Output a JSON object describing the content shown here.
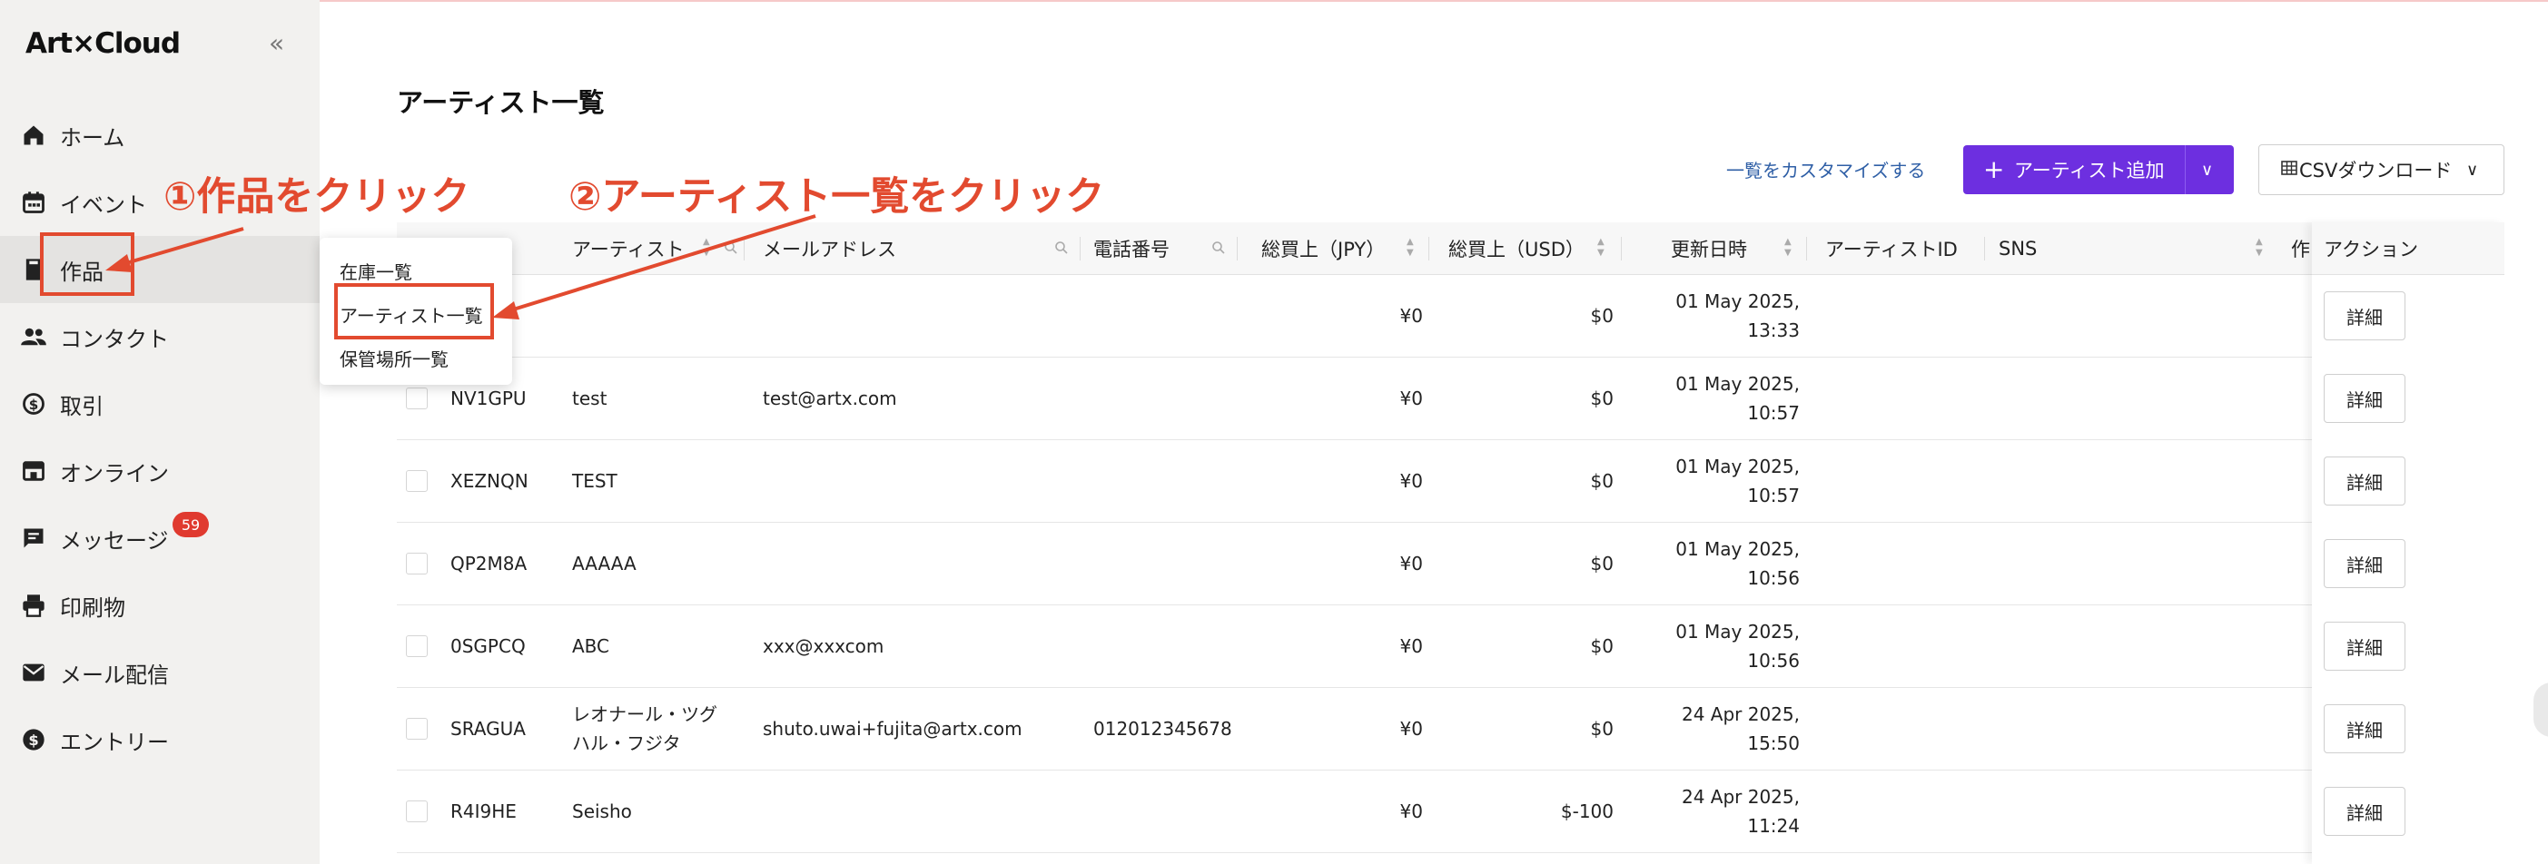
{
  "app": {
    "logo": "Art×Cloud"
  },
  "sidebar": {
    "items": [
      {
        "label": "ホーム",
        "icon": "home-icon"
      },
      {
        "label": "イベント",
        "icon": "calendar-icon"
      },
      {
        "label": "作品",
        "icon": "book-icon"
      },
      {
        "label": "コンタクト",
        "icon": "people-icon"
      },
      {
        "label": "取引",
        "icon": "exchange-icon"
      },
      {
        "label": "オンライン",
        "icon": "store-icon"
      },
      {
        "label": "メッセージ",
        "icon": "message-icon"
      },
      {
        "label": "印刷物",
        "icon": "printer-icon"
      },
      {
        "label": "メール配信",
        "icon": "mail-icon"
      },
      {
        "label": "エントリー",
        "icon": "dollar-icon"
      }
    ],
    "message_badge": "59"
  },
  "submenu": {
    "items": [
      "在庫一覧",
      "アーティスト一覧",
      "保管場所一覧"
    ]
  },
  "main": {
    "title": "アーティスト一覧",
    "customize_link": "一覧をカスタマイズする",
    "add_button": "アーティスト追加",
    "csv_button": "CSVダウンロード"
  },
  "table": {
    "columns": {
      "artist": "アーティスト",
      "email": "メールアドレス",
      "phone": "電話番号",
      "total_jpy": "総買上（JPY）",
      "total_usd": "総買上（USD）",
      "updated": "更新日時",
      "artist_id": "アーティストID",
      "sns": "SNS",
      "partial": "作",
      "action": "アクション"
    },
    "detail_label": "詳細",
    "rows": [
      {
        "code": "",
        "artist": "",
        "email": "",
        "phone": "",
        "jpy": "¥0",
        "usd": "$0",
        "date": "01 May 2025,",
        "time": "13:33"
      },
      {
        "code": "NV1GPU",
        "artist": "test",
        "email": "test@artx.com",
        "phone": "",
        "jpy": "¥0",
        "usd": "$0",
        "date": "01 May 2025,",
        "time": "10:57"
      },
      {
        "code": "XEZNQN",
        "artist": "TEST",
        "email": "",
        "phone": "",
        "jpy": "¥0",
        "usd": "$0",
        "date": "01 May 2025,",
        "time": "10:57"
      },
      {
        "code": "QP2M8A",
        "artist": "AAAAA",
        "email": "",
        "phone": "",
        "jpy": "¥0",
        "usd": "$0",
        "date": "01 May 2025,",
        "time": "10:56"
      },
      {
        "code": "0SGPCQ",
        "artist": "ABC",
        "email": "xxx@xxxcom",
        "phone": "",
        "jpy": "¥0",
        "usd": "$0",
        "date": "01 May 2025,",
        "time": "10:56"
      },
      {
        "code": "SRAGUA",
        "artist": "レオナール・ツグ",
        "artist2": "ハル・フジタ",
        "email": "shuto.uwai+fujita@artx.com",
        "phone": "012012345678",
        "jpy": "¥0",
        "usd": "$0",
        "date": "24 Apr 2025,",
        "time": "15:50"
      },
      {
        "code": "R4I9HE",
        "artist": "Seisho",
        "email": "",
        "phone": "",
        "jpy": "¥0",
        "usd": "$-100",
        "date": "24 Apr 2025,",
        "time": "11:24"
      }
    ]
  },
  "annotations": {
    "step1": "①作品をクリック",
    "step2": "②アーティスト一覧をクリック"
  },
  "colors": {
    "accent": "#6d2fe0",
    "annotation": "#e24a2f",
    "badge": "#e03a2f"
  }
}
